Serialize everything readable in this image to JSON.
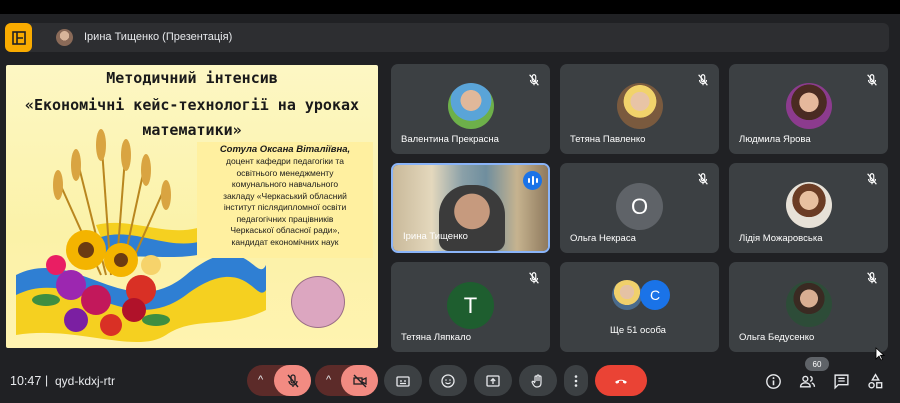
{
  "presenter": {
    "name": "Ірина Тищенко (Презентація)"
  },
  "slide": {
    "title_line1": "Методичний інтенсив",
    "title_line2": "«Економічні кейс-технології на уроках",
    "title_line3": "математики»",
    "author_name": "Сотула Оксана Віталіївна,",
    "author_lines": [
      "доцент кафедри педагогіки та",
      "освітнього менеджменту",
      "комунального навчального",
      "закладу «Черкаський обласний",
      "інститут післядипломної освіти",
      "педагогічних працівників",
      "Черкаської обласної ради»,",
      "кандидат економічних наук"
    ]
  },
  "tiles": [
    {
      "name": "Валентина Прекрасна",
      "muted": true
    },
    {
      "name": "Тетяна Павленко",
      "muted": true
    },
    {
      "name": "Людмила Ярова",
      "muted": true
    },
    {
      "name": "Ірина Тищенко",
      "speaking": true
    },
    {
      "name": "Ольга Некраса",
      "muted": true,
      "letter": "О",
      "color": "#5f6368"
    },
    {
      "name": "Лідія Можаровська",
      "muted": true
    },
    {
      "name": "Тетяна Ляпкало",
      "muted": true,
      "letter": "T",
      "color": "#1e5e2f"
    },
    {
      "name": "Ще 51 особа",
      "letter2": "C",
      "color2": "#1a73e8"
    },
    {
      "name": "Ольга Бедусенко",
      "muted": true
    }
  ],
  "bottom": {
    "time": "10:47",
    "separator": "|",
    "meeting_code": "qyd-kdxj-rtr",
    "participants_count": "60"
  },
  "icons": {
    "present": "presentation-icon",
    "mic_off": "mic-off-icon",
    "cam_off": "camera-off-icon",
    "captions": "captions-icon",
    "emoji": "emoji-icon",
    "present_now": "present-screen-icon",
    "raise_hand": "raise-hand-icon",
    "more": "more-vert-icon",
    "end_call": "end-call-icon",
    "info": "info-icon",
    "people": "people-icon",
    "chat": "chat-icon",
    "activities": "activities-icon"
  },
  "colors": {
    "accent_yellow": "#f9ab00",
    "end_call": "#ea4335",
    "mic_off": "#f28b82",
    "active_border": "#8ab4f8"
  }
}
